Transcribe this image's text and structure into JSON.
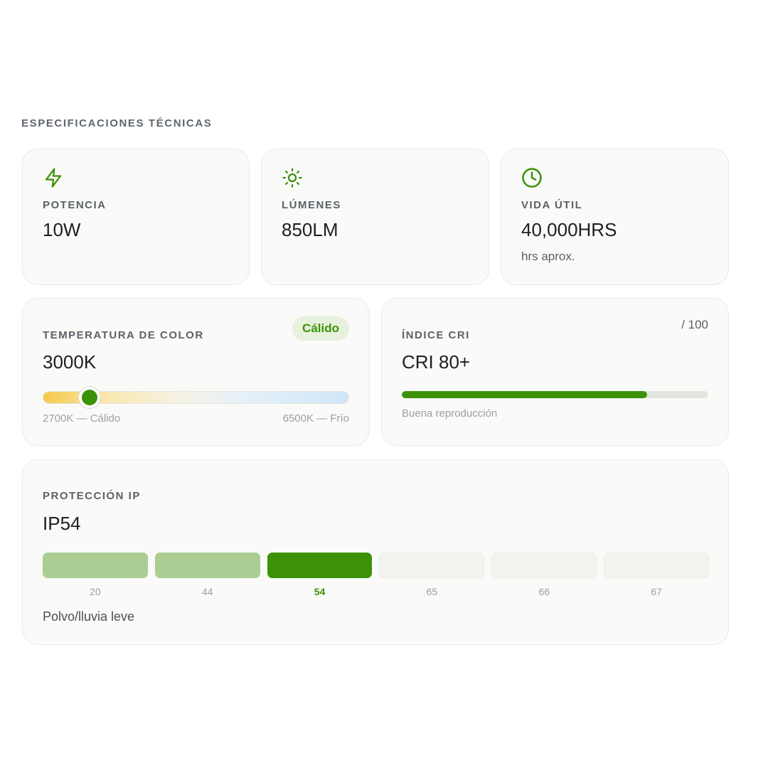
{
  "section_title": "ESPECIFICACIONES TÉCNICAS",
  "colors": {
    "accent": "#3b9208",
    "accent_light": "#aacd93",
    "badge_bg": "#e7f1dd"
  },
  "power": {
    "icon": "bolt-icon",
    "label": "POTENCIA",
    "value": "10W"
  },
  "lumens": {
    "icon": "sun-icon",
    "label": "LÚMENES",
    "value": "850LM"
  },
  "lifespan": {
    "icon": "clock-icon",
    "label": "VIDA ÚTIL",
    "value": "40,000HRS",
    "sub": "hrs aprox."
  },
  "color_temp": {
    "label": "TEMPERATURA DE COLOR",
    "value": "3000K",
    "badge": "Cálido",
    "range_min_label": "2700K — Cálido",
    "range_max_label": "6500K — Frío",
    "min_k": 2700,
    "max_k": 6500,
    "current_k": 3000
  },
  "cri": {
    "label": "ÍNDICE CRI",
    "value": "CRI 80+",
    "scale_label": "/ 100",
    "score": 80,
    "max": 100,
    "note": "Buena reproducción"
  },
  "ip": {
    "label": "PROTECCIÓN IP",
    "value": "IP54",
    "levels": [
      "20",
      "44",
      "54",
      "65",
      "66",
      "67"
    ],
    "current": "54",
    "description": "Polvo/lluvia leve"
  }
}
